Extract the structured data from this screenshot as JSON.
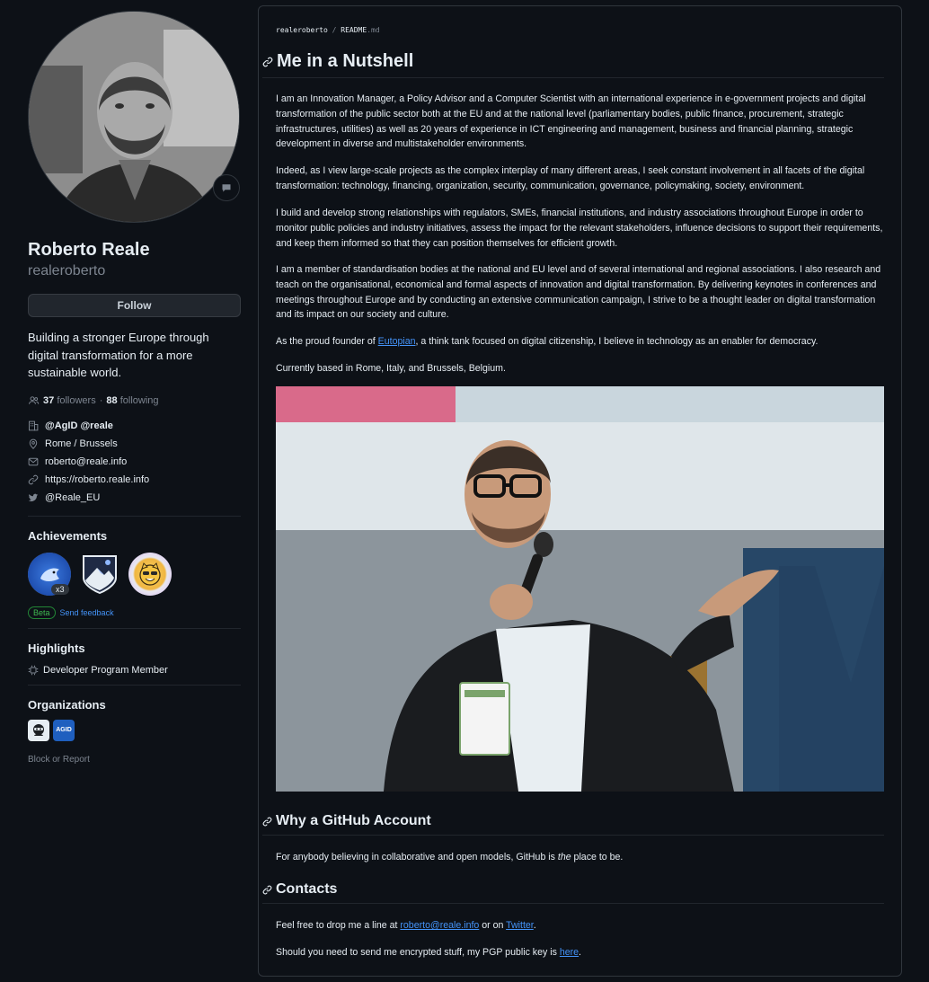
{
  "profile": {
    "name": "Roberto Reale",
    "login": "realeroberto",
    "follow_label": "Follow",
    "bio": "Building a stronger Europe through digital transformation for a more sustainable world.",
    "followers_count": "37",
    "followers_label": "followers",
    "separator": "·",
    "following_count": "88",
    "following_label": "following",
    "company": "@AgID @reale",
    "location": "Rome / Brussels",
    "email": "roberto@reale.info",
    "website": "https://roberto.reale.info",
    "twitter": "@Reale_EU"
  },
  "achievements": {
    "title": "Achievements",
    "badges": [
      {
        "name": "pull-shark-badge",
        "count": "x3"
      },
      {
        "name": "arctic-code-vault-badge",
        "count": ""
      },
      {
        "name": "yolo-badge",
        "count": ""
      }
    ],
    "beta_label": "Beta",
    "feedback_label": "Send feedback"
  },
  "highlights": {
    "title": "Highlights",
    "items": [
      "Developer Program Member"
    ]
  },
  "organizations": {
    "title": "Organizations",
    "items": [
      "",
      "AGID"
    ]
  },
  "block_report": "Block or Report",
  "readme": {
    "breadcrumb_user": "realeroberto",
    "breadcrumb_sep": "/",
    "breadcrumb_file": "README",
    "breadcrumb_ext": ".md",
    "h1": "Me in a Nutshell",
    "p1": "I am an Innovation Manager, a Policy Advisor and a Computer Scientist with an international experience in e-government projects and digital transformation of the public sector both at the EU and at the national level (parliamentary bodies, public finance, procurement, strategic infrastructures, utilities) as well as 20 years of experience in ICT engineering and management, business and financial planning, strategic development in diverse and multistakeholder environments.",
    "p2": "Indeed, as I view large-scale projects as the complex interplay of many different areas, I seek constant involvement in all facets of the digital transformation: technology, financing, organization, security, communication, governance, policymaking, society, environment.",
    "p3": "I build and develop strong relationships with regulators, SMEs, financial institutions, and industry associations throughout Europe in order to monitor public policies and industry initiatives, assess the impact for the relevant stakeholders, influence decisions to support their requirements, and keep them informed so that they can position themselves for efficient growth.",
    "p4": "I am a member of standardisation bodies at the national and EU level and of several international and regional associations. I also research and teach on the organisational, economical and formal aspects of innovation and digital transformation. By delivering keynotes in conferences and meetings throughout Europe and by conducting an extensive communication campaign, I strive to be a thought leader on digital transformation and its impact on our society and culture.",
    "p5_before": "As the proud founder of ",
    "p5_link": "Eutopian",
    "p5_after": ", a think tank focused on digital citizenship, I believe in technology as an enabler for democracy.",
    "p6": "Currently based in Rome, Italy, and Brussels, Belgium.",
    "h2_github": "Why a GitHub Account",
    "p7_before": "For anybody believing in collaborative and open models, GitHub is ",
    "p7_em": "the",
    "p7_after": " place to be.",
    "h2_contacts": "Contacts",
    "p8_before": "Feel free to drop me a line at ",
    "p8_email": "roberto@reale.info",
    "p8_mid": " or on ",
    "p8_twitter": "Twitter",
    "p8_end": ".",
    "p9_before": "Should you need to send me encrypted stuff, my PGP public key is ",
    "p9_link": "here",
    "p9_end": "."
  },
  "colors": {
    "background": "#0d1117",
    "border": "#30363d",
    "text": "#e6edf3",
    "muted": "#7d8590",
    "link": "#4493f8",
    "beta_green": "#3fb950"
  }
}
